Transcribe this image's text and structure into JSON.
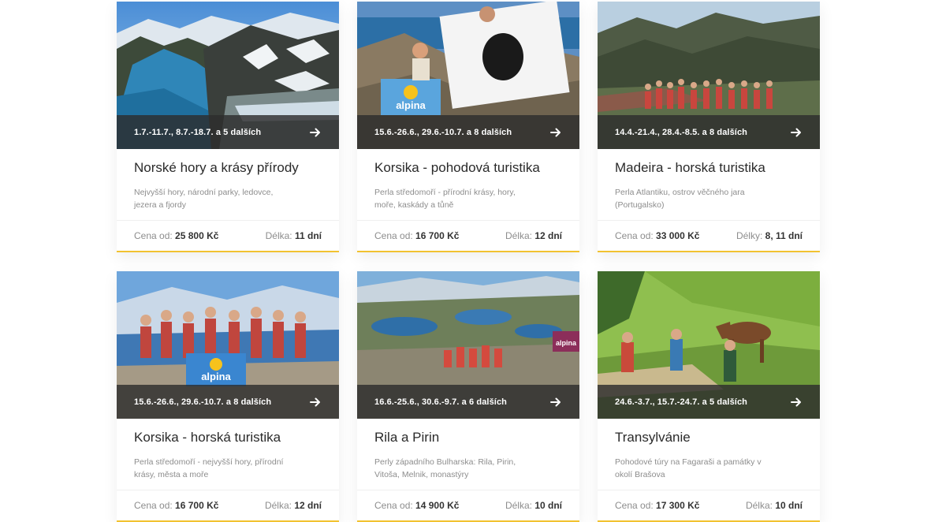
{
  "labels": {
    "price_prefix": "Cena od:"
  },
  "colors": {
    "accent": "#f2c230",
    "date_bar": "#2d2d2d"
  },
  "cards": [
    {
      "dates": "1.7.-11.7., 8.7.-18.7. a 5 dalších",
      "title": "Norské hory a krásy přírody",
      "desc_line1": "Nejvyšší hory, národní parky, ledovce,",
      "desc_line2": "jezera a fjordy",
      "price": "25 800 Kč",
      "duration_label": "Délka:",
      "duration": "11 dní",
      "icon": "arrow-right-icon"
    },
    {
      "dates": "15.6.-26.6., 29.6.-10.7. a 8 dalších",
      "title": "Korsika - pohodová turistika",
      "desc_line1": "Perla středomoří - přírodní krásy, hory,",
      "desc_line2": "moře, kaskády a tůně",
      "price": "16 700 Kč",
      "duration_label": "Délka:",
      "duration": "12 dní",
      "icon": "arrow-right-icon"
    },
    {
      "dates": "14.4.-21.4., 28.4.-8.5. a 8 dalších",
      "title": "Madeira - horská turistika",
      "desc_line1": "Perla Atlantiku, ostrov věčného jara",
      "desc_line2": "(Portugalsko)",
      "price": "33 000 Kč",
      "duration_label": "Délky:",
      "duration": "8, 11 dní",
      "icon": "arrow-right-icon"
    },
    {
      "dates": "15.6.-26.6., 29.6.-10.7. a 8 dalších",
      "title": "Korsika - horská turistika",
      "desc_line1": "Perla středomoří - nejvyšší hory, přírodní",
      "desc_line2": "krásy, města a moře",
      "price": "16 700 Kč",
      "duration_label": "Délka:",
      "duration": "12 dní",
      "icon": "arrow-right-icon"
    },
    {
      "dates": "16.6.-25.6., 30.6.-9.7. a 6 dalších",
      "title": "Rila a Pirin",
      "desc_line1": "Perly západního Bulharska: Rila, Pirin,",
      "desc_line2": "Vitoša, Melnik, monastýry",
      "price": "14 900 Kč",
      "duration_label": "Délka:",
      "duration": "10 dní",
      "icon": "arrow-right-icon"
    },
    {
      "dates": "24.6.-3.7., 15.7.-24.7. a 5 dalších",
      "title": "Transylvánie",
      "desc_line1": "Pohodové túry na Fagaraši a památky v",
      "desc_line2": "okolí Brašova",
      "price": "17 300 Kč",
      "duration_label": "Délka:",
      "duration": "10 dní",
      "icon": "arrow-right-icon"
    }
  ]
}
